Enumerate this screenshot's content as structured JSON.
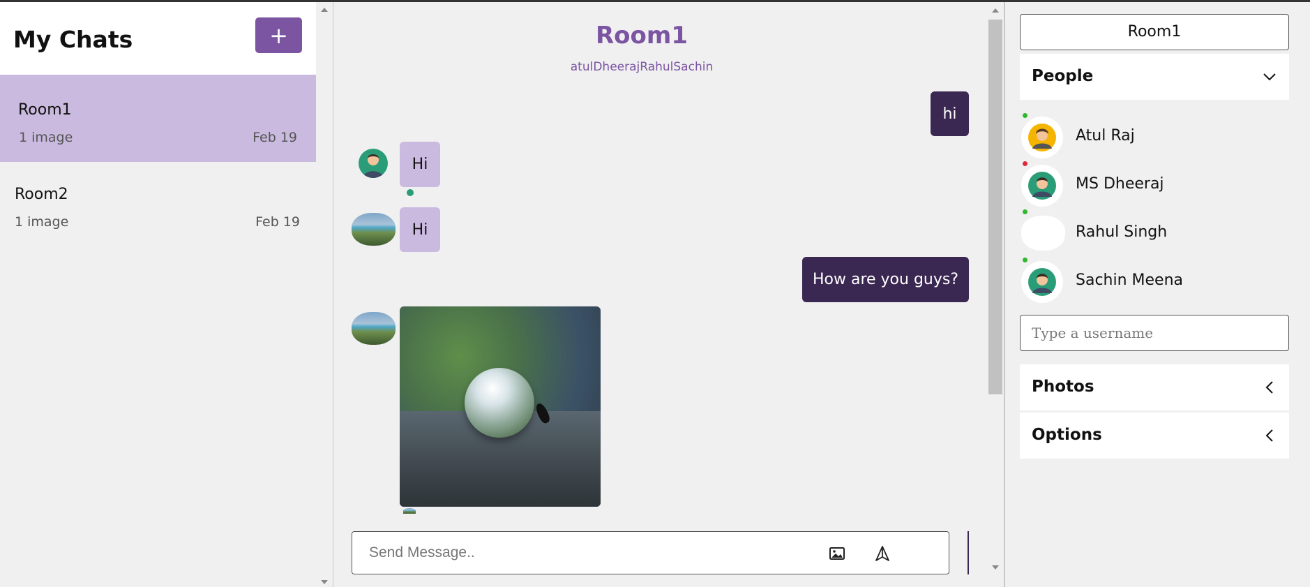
{
  "left": {
    "title": "My Chats",
    "add_label": "+",
    "chats": [
      {
        "name": "Room1",
        "preview": "1 image",
        "date": "Feb 19",
        "active": true
      },
      {
        "name": "Room2",
        "preview": "1 image",
        "date": "Feb 19",
        "active": false
      }
    ]
  },
  "center": {
    "room_title": "Room1",
    "members": "atulDheerajRahulSachin",
    "messages": [
      {
        "from": "me",
        "text": "hi"
      },
      {
        "from": "MS Dheeraj",
        "text": "Hi"
      },
      {
        "from": "Rahul Singh",
        "text": "Hi"
      },
      {
        "from": "me",
        "text": "How are you guys?"
      },
      {
        "from": "Rahul Singh",
        "type": "image",
        "icon": "water-drop-photo"
      }
    ],
    "composer": {
      "placeholder": "Send Message..",
      "image_icon": "image-icon",
      "send_icon": "send-icon"
    }
  },
  "right": {
    "room_name": "Room1",
    "people_label": "People",
    "people": [
      {
        "name": "Atul Raj",
        "status": "online"
      },
      {
        "name": "MS Dheeraj",
        "status": "offline"
      },
      {
        "name": "Rahul Singh",
        "status": "online"
      },
      {
        "name": "Sachin Meena",
        "status": "online"
      }
    ],
    "username_placeholder": "Type a username",
    "photos_label": "Photos",
    "options_label": "Options"
  },
  "colors": {
    "accent": "#7b54a2",
    "accent_light": "#cabadf",
    "my_bubble": "#3b2852",
    "online": "#2eb82e",
    "offline": "#e0283c"
  }
}
